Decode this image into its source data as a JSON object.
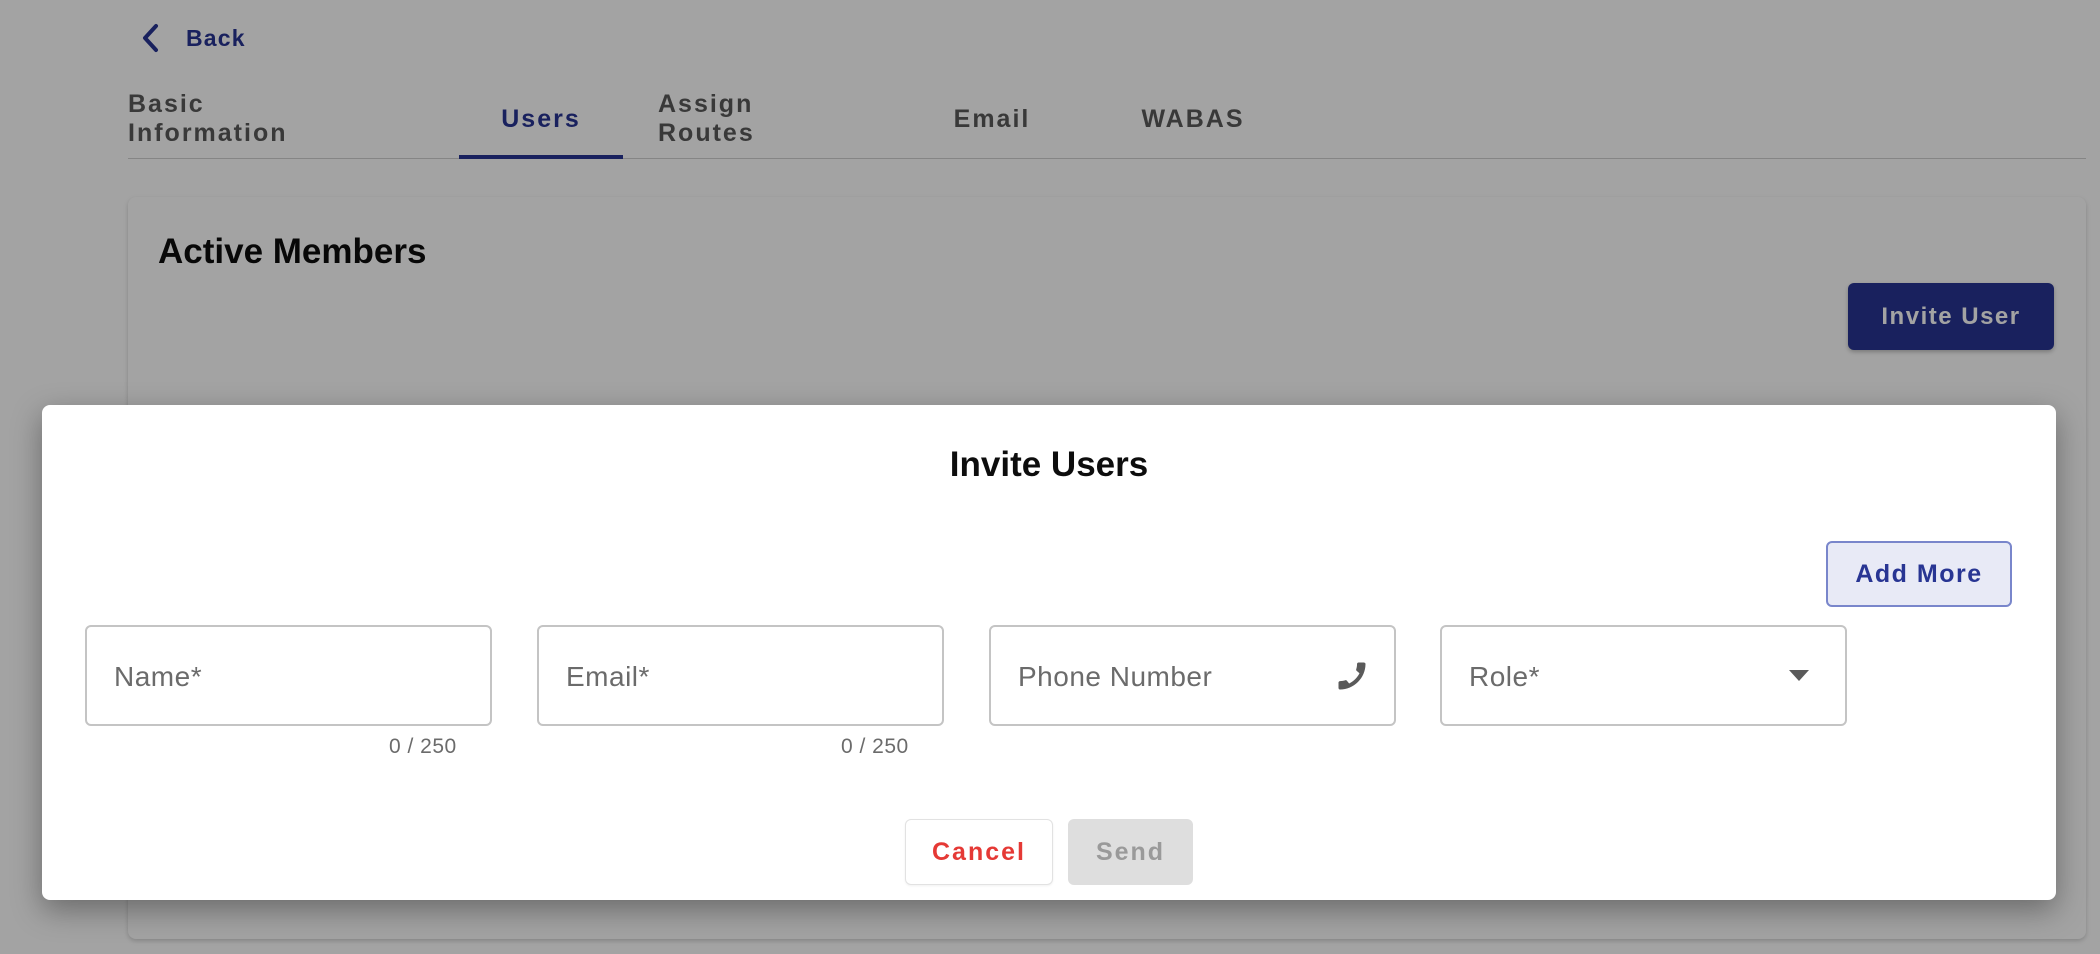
{
  "navigation": {
    "back_label": "Back"
  },
  "tabs": [
    {
      "label": "Basic Information",
      "active": false
    },
    {
      "label": "Users",
      "active": true
    },
    {
      "label": "Assign Routes",
      "active": false
    },
    {
      "label": "Email",
      "active": false
    },
    {
      "label": "WABAS",
      "active": false
    }
  ],
  "members_card": {
    "title": "Active Members",
    "invite_button_label": "Invite User"
  },
  "invite_dialog": {
    "title": "Invite Users",
    "add_more_label": "Add More",
    "fields": {
      "name": {
        "label": "Name*",
        "value": "",
        "counter": "0 / 250"
      },
      "email": {
        "label": "Email*",
        "value": "",
        "counter": "0 / 250"
      },
      "phone": {
        "label": "Phone Number",
        "value": "",
        "icon": "phone-icon"
      },
      "role": {
        "label": "Role*",
        "value": "",
        "icon": "chevron-down-icon"
      }
    },
    "cancel_label": "Cancel",
    "send_label": "Send",
    "send_enabled": false
  },
  "colors": {
    "primary": "#283593",
    "primary_light": "#e8eaf6",
    "danger": "#e53935",
    "disabled_bg": "#dedede"
  }
}
